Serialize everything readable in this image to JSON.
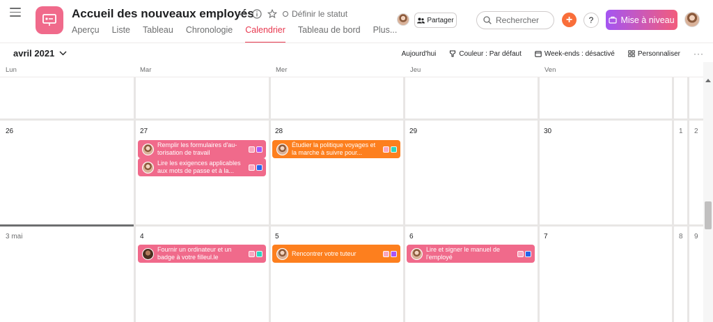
{
  "header": {
    "title": "Accueil des nouveaux employés",
    "set_status": "Définir le statut",
    "share": "Partager",
    "search_placeholder": "Rechercher",
    "plus": "+",
    "help": "?",
    "upgrade": "Mise à niveau"
  },
  "tabs": [
    "Aperçu",
    "Liste",
    "Tableau",
    "Chronologie",
    "Calendrier",
    "Tableau de bord",
    "Plus..."
  ],
  "active_tab": "Calendrier",
  "toolbar": {
    "month": "avril 2021",
    "today": "Aujourd'hui",
    "color": "Couleur : Par défaut",
    "weekends": "Week-ends : désactivé",
    "customize": "Personnaliser",
    "more": "···"
  },
  "calendar": {
    "day_headers": [
      "Lun",
      "Mar",
      "Mer",
      "Jeu",
      "Ven"
    ],
    "week1_dates": [
      "26",
      "27",
      "28",
      "29",
      "30",
      "1",
      "2"
    ],
    "week2_dates": [
      "3 mai",
      "4",
      "5",
      "6",
      "7",
      "8",
      "9"
    ],
    "tasks": [
      {
        "title": "Remplir les formulaires d'au-torisation de travail",
        "color": "#f06a8b",
        "tags": [
          "#f9a8c0",
          "#a855f7"
        ]
      },
      {
        "title": "Lire les exigences applicables aux mots de passe et à la...",
        "color": "#f06a8b",
        "tags": [
          "#f9a8c0",
          "#2563eb"
        ]
      },
      {
        "title": "Étudier la politique voyages et la marche à suivre pour...",
        "color": "#fd7f1e",
        "tags": [
          "#f9a8c0",
          "#2dd4bf"
        ]
      },
      {
        "title": "Fournir un ordinateur et un badge à votre filleul.le",
        "color": "#f06a8b",
        "tags": [
          "#f9a8c0",
          "#2dd4bf"
        ]
      },
      {
        "title": "Rencontrer votre tuteur",
        "color": "#fd7f1e",
        "tags": [
          "#f9a8c0",
          "#a855f7"
        ]
      },
      {
        "title": "Lire et signer le manuel de l'employé",
        "color": "#f06a8b",
        "tags": [
          "#f9a8c0",
          "#2563eb"
        ]
      }
    ]
  }
}
